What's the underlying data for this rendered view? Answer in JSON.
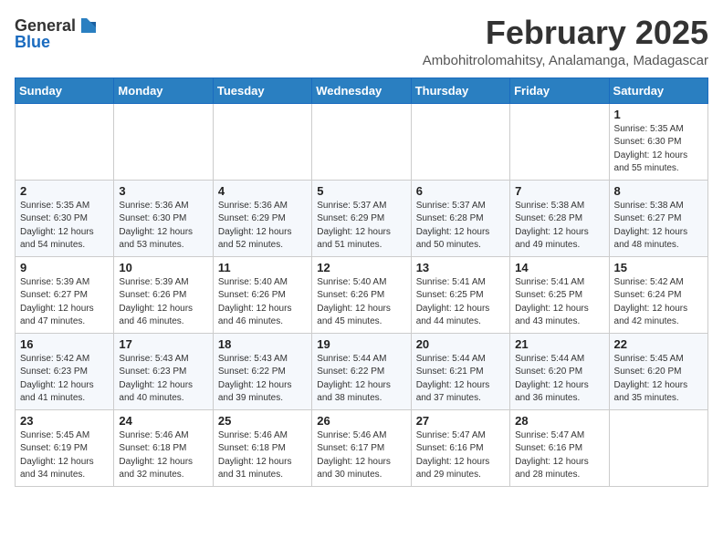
{
  "logo": {
    "general": "General",
    "blue": "Blue"
  },
  "header": {
    "month": "February 2025",
    "location": "Ambohitrolomahitsy, Analamanga, Madagascar"
  },
  "weekdays": [
    "Sunday",
    "Monday",
    "Tuesday",
    "Wednesday",
    "Thursday",
    "Friday",
    "Saturday"
  ],
  "weeks": [
    [
      {
        "day": "",
        "info": ""
      },
      {
        "day": "",
        "info": ""
      },
      {
        "day": "",
        "info": ""
      },
      {
        "day": "",
        "info": ""
      },
      {
        "day": "",
        "info": ""
      },
      {
        "day": "",
        "info": ""
      },
      {
        "day": "1",
        "info": "Sunrise: 5:35 AM\nSunset: 6:30 PM\nDaylight: 12 hours\nand 55 minutes."
      }
    ],
    [
      {
        "day": "2",
        "info": "Sunrise: 5:35 AM\nSunset: 6:30 PM\nDaylight: 12 hours\nand 54 minutes."
      },
      {
        "day": "3",
        "info": "Sunrise: 5:36 AM\nSunset: 6:30 PM\nDaylight: 12 hours\nand 53 minutes."
      },
      {
        "day": "4",
        "info": "Sunrise: 5:36 AM\nSunset: 6:29 PM\nDaylight: 12 hours\nand 52 minutes."
      },
      {
        "day": "5",
        "info": "Sunrise: 5:37 AM\nSunset: 6:29 PM\nDaylight: 12 hours\nand 51 minutes."
      },
      {
        "day": "6",
        "info": "Sunrise: 5:37 AM\nSunset: 6:28 PM\nDaylight: 12 hours\nand 50 minutes."
      },
      {
        "day": "7",
        "info": "Sunrise: 5:38 AM\nSunset: 6:28 PM\nDaylight: 12 hours\nand 49 minutes."
      },
      {
        "day": "8",
        "info": "Sunrise: 5:38 AM\nSunset: 6:27 PM\nDaylight: 12 hours\nand 48 minutes."
      }
    ],
    [
      {
        "day": "9",
        "info": "Sunrise: 5:39 AM\nSunset: 6:27 PM\nDaylight: 12 hours\nand 47 minutes."
      },
      {
        "day": "10",
        "info": "Sunrise: 5:39 AM\nSunset: 6:26 PM\nDaylight: 12 hours\nand 46 minutes."
      },
      {
        "day": "11",
        "info": "Sunrise: 5:40 AM\nSunset: 6:26 PM\nDaylight: 12 hours\nand 46 minutes."
      },
      {
        "day": "12",
        "info": "Sunrise: 5:40 AM\nSunset: 6:26 PM\nDaylight: 12 hours\nand 45 minutes."
      },
      {
        "day": "13",
        "info": "Sunrise: 5:41 AM\nSunset: 6:25 PM\nDaylight: 12 hours\nand 44 minutes."
      },
      {
        "day": "14",
        "info": "Sunrise: 5:41 AM\nSunset: 6:25 PM\nDaylight: 12 hours\nand 43 minutes."
      },
      {
        "day": "15",
        "info": "Sunrise: 5:42 AM\nSunset: 6:24 PM\nDaylight: 12 hours\nand 42 minutes."
      }
    ],
    [
      {
        "day": "16",
        "info": "Sunrise: 5:42 AM\nSunset: 6:23 PM\nDaylight: 12 hours\nand 41 minutes."
      },
      {
        "day": "17",
        "info": "Sunrise: 5:43 AM\nSunset: 6:23 PM\nDaylight: 12 hours\nand 40 minutes."
      },
      {
        "day": "18",
        "info": "Sunrise: 5:43 AM\nSunset: 6:22 PM\nDaylight: 12 hours\nand 39 minutes."
      },
      {
        "day": "19",
        "info": "Sunrise: 5:44 AM\nSunset: 6:22 PM\nDaylight: 12 hours\nand 38 minutes."
      },
      {
        "day": "20",
        "info": "Sunrise: 5:44 AM\nSunset: 6:21 PM\nDaylight: 12 hours\nand 37 minutes."
      },
      {
        "day": "21",
        "info": "Sunrise: 5:44 AM\nSunset: 6:20 PM\nDaylight: 12 hours\nand 36 minutes."
      },
      {
        "day": "22",
        "info": "Sunrise: 5:45 AM\nSunset: 6:20 PM\nDaylight: 12 hours\nand 35 minutes."
      }
    ],
    [
      {
        "day": "23",
        "info": "Sunrise: 5:45 AM\nSunset: 6:19 PM\nDaylight: 12 hours\nand 34 minutes."
      },
      {
        "day": "24",
        "info": "Sunrise: 5:46 AM\nSunset: 6:18 PM\nDaylight: 12 hours\nand 32 minutes."
      },
      {
        "day": "25",
        "info": "Sunrise: 5:46 AM\nSunset: 6:18 PM\nDaylight: 12 hours\nand 31 minutes."
      },
      {
        "day": "26",
        "info": "Sunrise: 5:46 AM\nSunset: 6:17 PM\nDaylight: 12 hours\nand 30 minutes."
      },
      {
        "day": "27",
        "info": "Sunrise: 5:47 AM\nSunset: 6:16 PM\nDaylight: 12 hours\nand 29 minutes."
      },
      {
        "day": "28",
        "info": "Sunrise: 5:47 AM\nSunset: 6:16 PM\nDaylight: 12 hours\nand 28 minutes."
      },
      {
        "day": "",
        "info": ""
      }
    ]
  ]
}
